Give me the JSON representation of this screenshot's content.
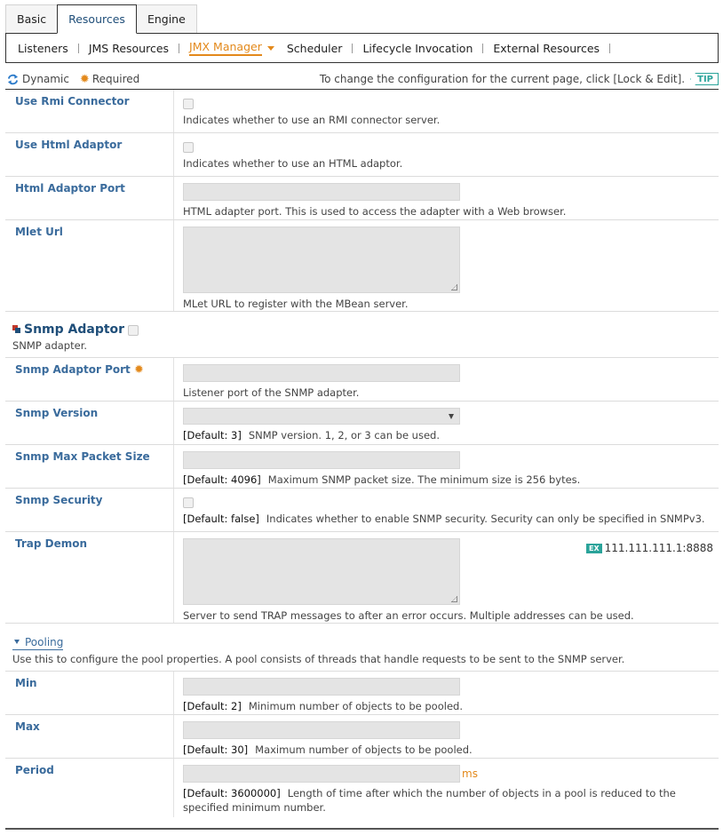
{
  "tabs": [
    "Basic",
    "Resources",
    "Engine"
  ],
  "active_tab": "Resources",
  "subnav": [
    "Listeners",
    "JMS Resources",
    "JMX Manager",
    "Scheduler",
    "Lifecycle Invocation",
    "External Resources"
  ],
  "active_subnav": "JMX Manager",
  "legend": {
    "dynamic": "Dynamic",
    "required": "Required",
    "hint": "To change the configuration for the current page, click [Lock & Edit].",
    "tip": "TIP"
  },
  "fields": [
    {
      "label": "Use Rmi Connector",
      "type": "checkbox",
      "desc": "Indicates whether to use an RMI connector server."
    },
    {
      "label": "Use Html Adaptor",
      "type": "checkbox",
      "desc": "Indicates whether to use an HTML adaptor."
    },
    {
      "label": "Html Adaptor Port",
      "type": "input",
      "value": "",
      "desc": "HTML adapter port. This is used to access the adapter with a Web browser."
    },
    {
      "label": "Mlet Url",
      "type": "textarea",
      "value": "",
      "desc": "MLet URL to register with the MBean server."
    }
  ],
  "snmp": {
    "title": "Snmp Adaptor",
    "desc": "SNMP adapter.",
    "fields": [
      {
        "label": "Snmp Adaptor Port",
        "required": true,
        "type": "input",
        "value": "",
        "desc": "Listener port of the SNMP adapter."
      },
      {
        "label": "Snmp Version",
        "type": "select",
        "value": "",
        "default": "[Default: 3]",
        "desc": "SNMP version. 1, 2, or 3 can be used."
      },
      {
        "label": "Snmp Max Packet Size",
        "type": "input",
        "value": "",
        "default": "[Default: 4096]",
        "desc": "Maximum SNMP packet size. The minimum size is 256 bytes."
      },
      {
        "label": "Snmp Security",
        "type": "checkbox",
        "default": "[Default: false]",
        "desc": "Indicates whether to enable SNMP security. Security can only be specified in SNMPv3."
      },
      {
        "label": "Trap Demon",
        "type": "textarea",
        "value": "",
        "example_badge": "EX",
        "example": "111.111.111.1:8888",
        "desc": "Server to send TRAP messages to after an error occurs. Multiple addresses can be used."
      }
    ]
  },
  "pooling": {
    "title": "Pooling",
    "desc": "Use this to configure the pool properties. A pool consists of threads that handle requests to be sent to the SNMP server.",
    "fields": [
      {
        "label": "Min",
        "type": "input",
        "value": "",
        "default": "[Default: 2]",
        "desc": "Minimum number of objects to be pooled."
      },
      {
        "label": "Max",
        "type": "input",
        "value": "",
        "default": "[Default: 30]",
        "desc": "Maximum number of objects to be pooled."
      },
      {
        "label": "Period",
        "type": "input",
        "value": "",
        "unit": "ms",
        "default": "[Default: 3600000]",
        "desc": "Length of time after which the number of objects in a pool is reduced to the specified minimum number."
      }
    ]
  }
}
